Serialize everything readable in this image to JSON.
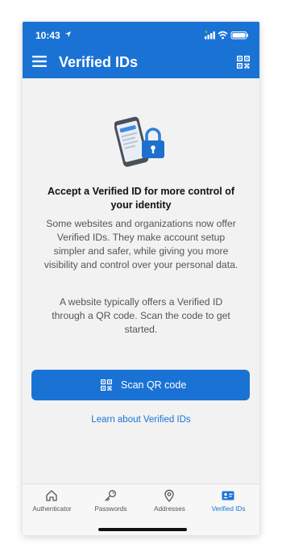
{
  "status": {
    "time": "10:43"
  },
  "appbar": {
    "title": "Verified IDs"
  },
  "content": {
    "heading": "Accept a Verified ID for more control of your identity",
    "paragraph1": "Some websites and organizations now offer Verified IDs. They make account setup simpler and safer, while giving you more visibility and control over your personal data.",
    "paragraph2": "A website typically offers a Verified ID through a QR code. Scan the code to get started.",
    "scan_button": "Scan QR code",
    "learn_link": "Learn about Verified IDs"
  },
  "tabs": [
    {
      "label": "Authenticator",
      "icon": "house-icon",
      "active": false
    },
    {
      "label": "Passwords",
      "icon": "key-icon",
      "active": false
    },
    {
      "label": "Addresses",
      "icon": "location-pin-icon",
      "active": false
    },
    {
      "label": "Verified IDs",
      "icon": "id-card-icon",
      "active": true
    }
  ],
  "colors": {
    "accent": "#1a73d4",
    "background": "#f2f2f2"
  }
}
